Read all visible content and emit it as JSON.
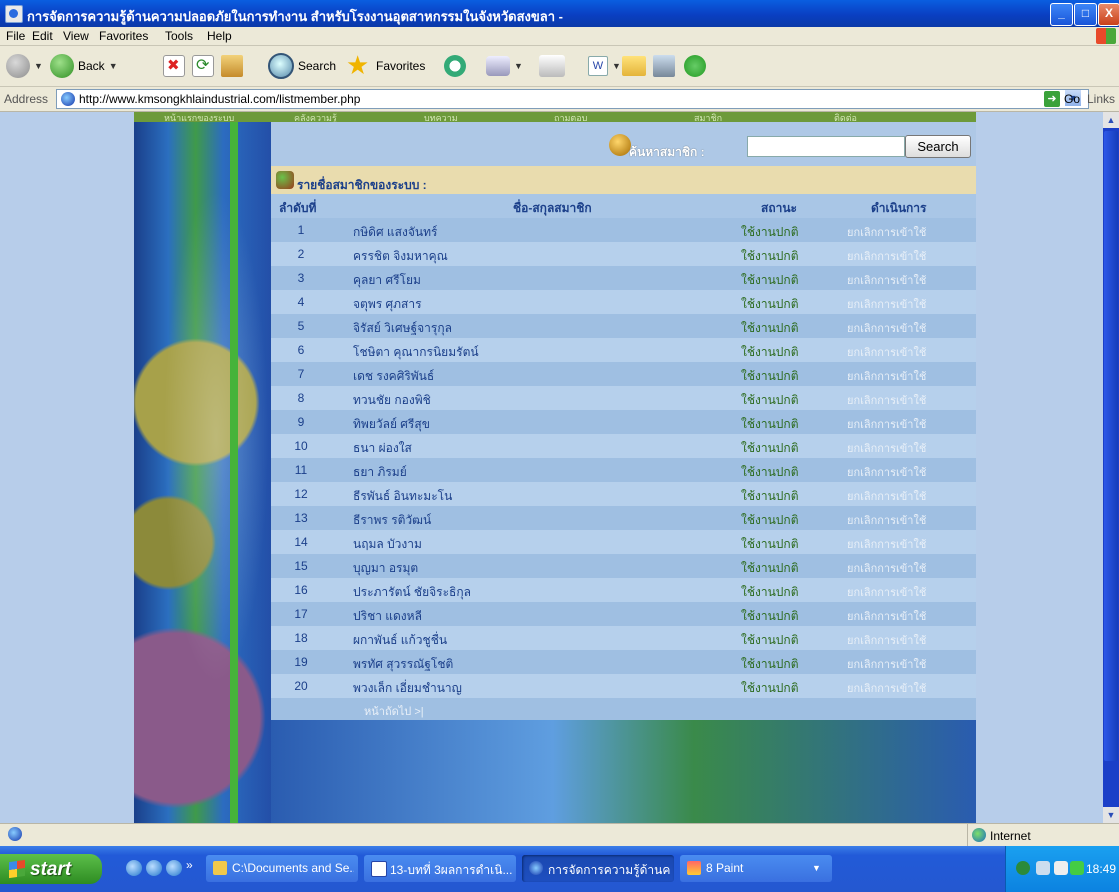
{
  "window": {
    "title": "การจัดการความรู้ด้านความปลอดภัยในการทำงาน สำหรับโรงงานอุตสาหกรรมในจังหวัดสงขลา -",
    "controls": {
      "minimize": "_",
      "maximize": "□",
      "close": "X"
    }
  },
  "menu": [
    "File",
    "Edit",
    "View",
    "Favorites",
    "Tools",
    "Help"
  ],
  "toolbar": {
    "back_label": "Back",
    "search_label": "Search",
    "favorites_label": "Favorites"
  },
  "address": {
    "label": "Address",
    "url": "http://www.kmsongkhlaindustrial.com/listmember.php",
    "go_label": "Go",
    "links_label": "Links"
  },
  "site": {
    "top_nav": [
      "หน้าแรกของระบบ",
      "คลังความรู้",
      "บทความ",
      "ถามตอบ",
      "สมาชิก",
      "ติดต่อ"
    ],
    "search_label": "ค้นหาสมาชิก :",
    "search_value": "",
    "search_button": "Search",
    "list_title": "รายชื่อสมาชิกของระบบ :",
    "columns": {
      "no": "ลำดับที่",
      "name": "ชื่อ-สกุลสมาชิก",
      "status": "สถานะ",
      "action": "ดำเนินการ"
    },
    "members": [
      {
        "no": "1",
        "name": "กษิดิศ แสงจันทร์",
        "status": "ใช้งานปกติ",
        "action": "ยกเลิกการเข้าใช้"
      },
      {
        "no": "2",
        "name": "ครรชิต จิงมหาคุณ",
        "status": "ใช้งานปกติ",
        "action": "ยกเลิกการเข้าใช้"
      },
      {
        "no": "3",
        "name": "คุลยา ศรีโยม",
        "status": "ใช้งานปกติ",
        "action": "ยกเลิกการเข้าใช้"
      },
      {
        "no": "4",
        "name": "จตุพร ศุภสาร",
        "status": "ใช้งานปกติ",
        "action": "ยกเลิกการเข้าใช้"
      },
      {
        "no": "5",
        "name": "จิรัสย์ วิเศษฐ์จารุกุล",
        "status": "ใช้งานปกติ",
        "action": "ยกเลิกการเข้าใช้"
      },
      {
        "no": "6",
        "name": "โชษิตา คุณากรนิยมรัตน์",
        "status": "ใช้งานปกติ",
        "action": "ยกเลิกการเข้าใช้"
      },
      {
        "no": "7",
        "name": "เดช รงคศิริพันธ์",
        "status": "ใช้งานปกติ",
        "action": "ยกเลิกการเข้าใช้"
      },
      {
        "no": "8",
        "name": "ทวนชัย กองพิชิ",
        "status": "ใช้งานปกติ",
        "action": "ยกเลิกการเข้าใช้"
      },
      {
        "no": "9",
        "name": "ทิพยวัลย์ ศรีสุข",
        "status": "ใช้งานปกติ",
        "action": "ยกเลิกการเข้าใช้"
      },
      {
        "no": "10",
        "name": "ธนา ผ่องใส",
        "status": "ใช้งานปกติ",
        "action": "ยกเลิกการเข้าใช้"
      },
      {
        "no": "11",
        "name": "ธยา ภิรมย์",
        "status": "ใช้งานปกติ",
        "action": "ยกเลิกการเข้าใช้"
      },
      {
        "no": "12",
        "name": "ธีรพันธ์ อินทะมะโน",
        "status": "ใช้งานปกติ",
        "action": "ยกเลิกการเข้าใช้"
      },
      {
        "no": "13",
        "name": "ธีราพร รติวัฒน์",
        "status": "ใช้งานปกติ",
        "action": "ยกเลิกการเข้าใช้"
      },
      {
        "no": "14",
        "name": "นฤมล บัวงาม",
        "status": "ใช้งานปกติ",
        "action": "ยกเลิกการเข้าใช้"
      },
      {
        "no": "15",
        "name": "บุญมา อรมุต",
        "status": "ใช้งานปกติ",
        "action": "ยกเลิกการเข้าใช้"
      },
      {
        "no": "16",
        "name": "ประภารัตน์ ชัยจิระธิกุล",
        "status": "ใช้งานปกติ",
        "action": "ยกเลิกการเข้าใช้"
      },
      {
        "no": "17",
        "name": "ปริชา แดงหลี",
        "status": "ใช้งานปกติ",
        "action": "ยกเลิกการเข้าใช้"
      },
      {
        "no": "18",
        "name": "ผกาพันธ์ แก้วชูชื่น",
        "status": "ใช้งานปกติ",
        "action": "ยกเลิกการเข้าใช้"
      },
      {
        "no": "19",
        "name": "พรทัศ สุวรรณัฐโชติ",
        "status": "ใช้งานปกติ",
        "action": "ยกเลิกการเข้าใช้"
      },
      {
        "no": "20",
        "name": "พวงเล็ก เอี่ยมชำนาญ",
        "status": "ใช้งานปกติ",
        "action": "ยกเลิกการเข้าใช้"
      }
    ],
    "pager": "หน้าถัดไป >|"
  },
  "statusbar": {
    "zone": "Internet"
  },
  "taskbar": {
    "start": "start",
    "tasks": [
      {
        "label": "C:\\Documents and Se..."
      },
      {
        "label": "13-บทที่ 3ผลการดำเนิ..."
      },
      {
        "label": "การจัดการความรู้ด้านค..."
      },
      {
        "label": "8 Paint"
      }
    ],
    "clock": "18:49"
  },
  "colors": {
    "xp_blue": "#0a4fd4",
    "status_green": "#2c6b1e",
    "name_blue": "#1b3f8a",
    "list_header_bg": "#e9dcae"
  },
  "icons": {
    "back": "back-arrow-icon",
    "forward": "forward-arrow-icon",
    "stop": "stop-icon",
    "refresh": "refresh-icon",
    "home": "home-icon",
    "search": "search-icon",
    "favorites": "star-icon",
    "history": "history-icon",
    "mail": "mail-icon",
    "print": "printer-icon",
    "word": "word-icon",
    "folder": "folder-icon",
    "research": "research-icon",
    "messenger": "messenger-icon"
  }
}
